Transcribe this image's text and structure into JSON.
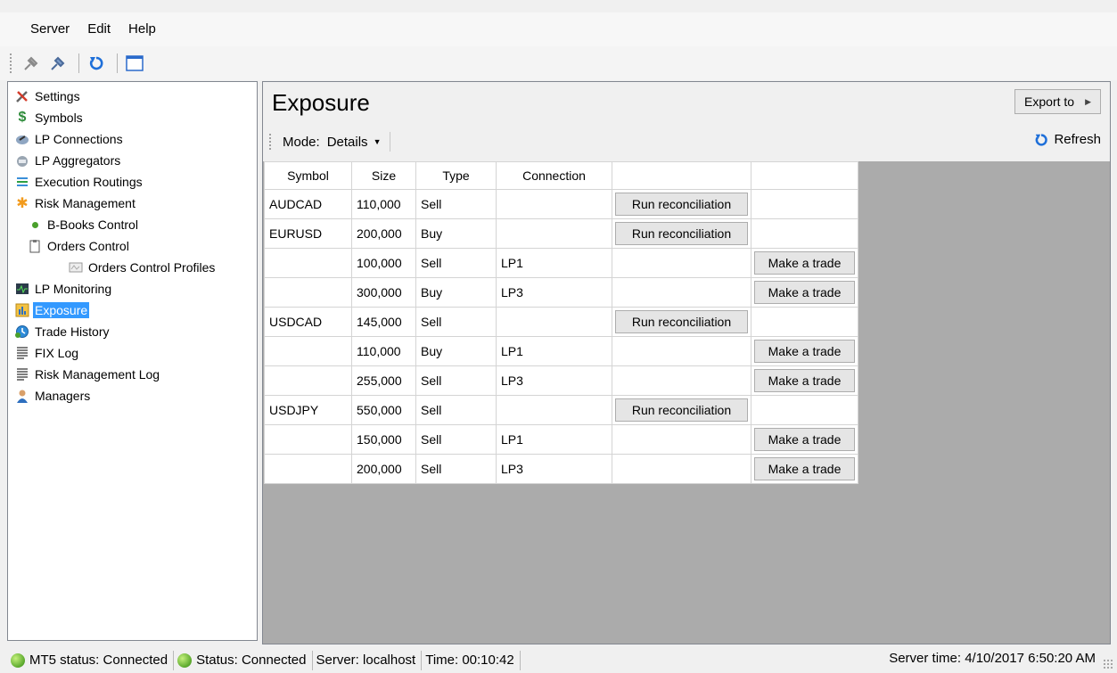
{
  "menu": [
    "Server",
    "Edit",
    "Help"
  ],
  "toolbar": {
    "buttons": [
      "connect-icon",
      "disconnect-icon",
      "refresh-icon",
      "window-icon"
    ]
  },
  "tree": {
    "items": [
      {
        "label": "Settings",
        "icon": "tools-icon",
        "level": 0
      },
      {
        "label": "Symbols",
        "icon": "dollar-icon",
        "level": 0
      },
      {
        "label": "LP Connections",
        "icon": "plug-icon",
        "level": 0
      },
      {
        "label": "LP Aggregators",
        "icon": "aggregator-icon",
        "level": 0
      },
      {
        "label": "Execution Routings",
        "icon": "routing-icon",
        "level": 0
      },
      {
        "label": "Risk Management",
        "icon": "risk-icon",
        "level": 0
      },
      {
        "label": "B-Books Control",
        "icon": "dot-icon",
        "level": 1
      },
      {
        "label": "Orders Control",
        "icon": "clipboard-icon",
        "level": 1
      },
      {
        "label": "Orders Control Profiles",
        "icon": "profile-icon",
        "level": 2
      },
      {
        "label": "LP Monitoring",
        "icon": "monitor-icon",
        "level": 0
      },
      {
        "label": "Exposure",
        "icon": "chart-icon",
        "level": 0,
        "selected": true
      },
      {
        "label": "Trade History",
        "icon": "history-icon",
        "level": 0
      },
      {
        "label": "FIX Log",
        "icon": "log-icon",
        "level": 0
      },
      {
        "label": "Risk Management Log",
        "icon": "log-icon",
        "level": 0
      },
      {
        "label": "Managers",
        "icon": "user-icon",
        "level": 0
      }
    ]
  },
  "main": {
    "title": "Exposure",
    "export_label": "Export to",
    "mode_label": "Mode:",
    "mode_value": "Details",
    "refresh_label": "Refresh"
  },
  "grid": {
    "headers": [
      "Symbol",
      "Size",
      "Type",
      "Connection",
      "",
      ""
    ],
    "rows": [
      {
        "symbol": "AUDCAD",
        "size": "110,000",
        "type": "Sell",
        "connection": "",
        "action": "Run reconciliation"
      },
      {
        "symbol": "EURUSD",
        "size": "200,000",
        "type": "Buy",
        "connection": "",
        "action": "Run reconciliation"
      },
      {
        "symbol": "",
        "size": "100,000",
        "type": "Sell",
        "connection": "LP1",
        "action": "Make a trade"
      },
      {
        "symbol": "",
        "size": "300,000",
        "type": "Buy",
        "connection": "LP3",
        "action": "Make a trade"
      },
      {
        "symbol": "USDCAD",
        "size": "145,000",
        "type": "Sell",
        "connection": "",
        "action": "Run reconciliation"
      },
      {
        "symbol": "",
        "size": "110,000",
        "type": "Buy",
        "connection": "LP1",
        "action": "Make a trade"
      },
      {
        "symbol": "",
        "size": "255,000",
        "type": "Sell",
        "connection": "LP3",
        "action": "Make a trade"
      },
      {
        "symbol": "USDJPY",
        "size": "550,000",
        "type": "Sell",
        "connection": "",
        "action": "Run reconciliation"
      },
      {
        "symbol": "",
        "size": "150,000",
        "type": "Sell",
        "connection": "LP1",
        "action": "Make a trade"
      },
      {
        "symbol": "",
        "size": "200,000",
        "type": "Sell",
        "connection": "LP3",
        "action": "Make a trade"
      }
    ]
  },
  "status": {
    "mt5": "MT5 status: Connected",
    "status": "Status: Connected",
    "server": "Server: localhost",
    "time": "Time: 00:10:42",
    "server_time": "Server time: 4/10/2017 6:50:20 AM"
  },
  "colors": {
    "selection": "#3399ff",
    "workspace": "#ababab",
    "refresh_icon": "#1e6fd9",
    "status_ok": "#5aa82c"
  }
}
